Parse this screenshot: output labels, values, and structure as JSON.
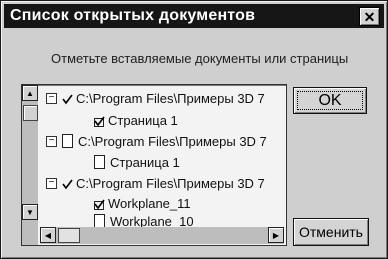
{
  "window": {
    "title": "Список открытых документов"
  },
  "instruction": "Отметьте вставляемые документы или страницы",
  "tree": [
    {
      "label": "C:\\Program Files\\Примеры 3D 7",
      "checked": true,
      "level": 0,
      "icon": "expander-minus"
    },
    {
      "label": "Страница 1",
      "checked": true,
      "level": 1,
      "icon": "checkbox"
    },
    {
      "label": "C:\\Program Files\\Примеры 3D 7",
      "checked": false,
      "level": 0,
      "icon": "document-icon"
    },
    {
      "label": "Страница 1",
      "checked": false,
      "level": 1,
      "icon": "document-icon"
    },
    {
      "label": "C:\\Program Files\\Примеры 3D 7",
      "checked": true,
      "level": 0,
      "icon": "expander-minus"
    },
    {
      "label": "Workplane_11",
      "checked": true,
      "level": 1,
      "icon": "checkbox"
    },
    {
      "label": "Workplane_10",
      "checked": false,
      "level": 1,
      "icon": "document-icon"
    }
  ],
  "buttons": {
    "ok": "OK",
    "cancel": "Отменить"
  },
  "icons": {
    "close": "close-icon",
    "up": "scroll-up-icon",
    "down": "scroll-down-icon",
    "left": "scroll-left-icon",
    "right": "scroll-right-icon"
  }
}
